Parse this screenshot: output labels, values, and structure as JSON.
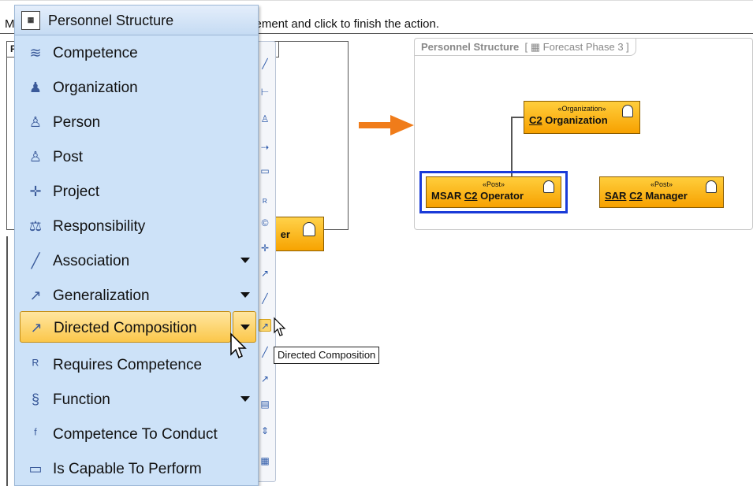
{
  "instruction": "Move the cursor over the target element and click to finish the action.",
  "instruction_visible": "Mo",
  "instruction_tail": "get element and click to finish the action.",
  "left_diagram": {
    "tab_end": "]",
    "box_label": "er"
  },
  "palette": {
    "header": "Personnel Structure",
    "header_icon": "diagram-icon",
    "items": [
      {
        "label": "Competence",
        "icon": "layers-icon"
      },
      {
        "label": "Organization",
        "icon": "people-icon"
      },
      {
        "label": "Person",
        "icon": "person-icon"
      },
      {
        "label": "Post",
        "icon": "person-icon"
      },
      {
        "label": "Project",
        "icon": "project-icon"
      },
      {
        "label": "Responsibility",
        "icon": "scale-icon"
      },
      {
        "label": "Association",
        "icon": "line-icon",
        "dropdown": true
      },
      {
        "label": "Generalization",
        "icon": "generalization-icon",
        "dropdown": true
      },
      {
        "label": "Directed Composition",
        "icon": "composition-icon",
        "dropdown": true,
        "selected": true
      },
      {
        "label": "Requires Competence",
        "icon": "requires-icon"
      },
      {
        "label": "Function",
        "icon": "function-icon",
        "dropdown": true
      },
      {
        "label": "Competence To Conduct",
        "icon": "conduct-icon"
      },
      {
        "label": "Is Capable To Perform",
        "icon": "capable-icon"
      }
    ]
  },
  "tooltip": "Directed Composition",
  "right_diagram": {
    "title": "Personnel Structure",
    "subtitle": "Forecast Phase 3",
    "org_node": {
      "stereotype": "«Organization»",
      "prefix": "C2",
      "name": " Organization"
    },
    "msar_node": {
      "stereotype": "«Post»",
      "lead": "MSAR ",
      "prefix": "C2",
      "name": " Operator"
    },
    "sar_node": {
      "stereotype": "«Post»",
      "lead": "SAR",
      "prefix": "C2",
      "name": " Manager"
    }
  },
  "colors": {
    "accent": "#f07c1a",
    "selection": "#1a3bd8",
    "node_fill": "#f7a100",
    "palette_bg": "#cde2f8"
  }
}
